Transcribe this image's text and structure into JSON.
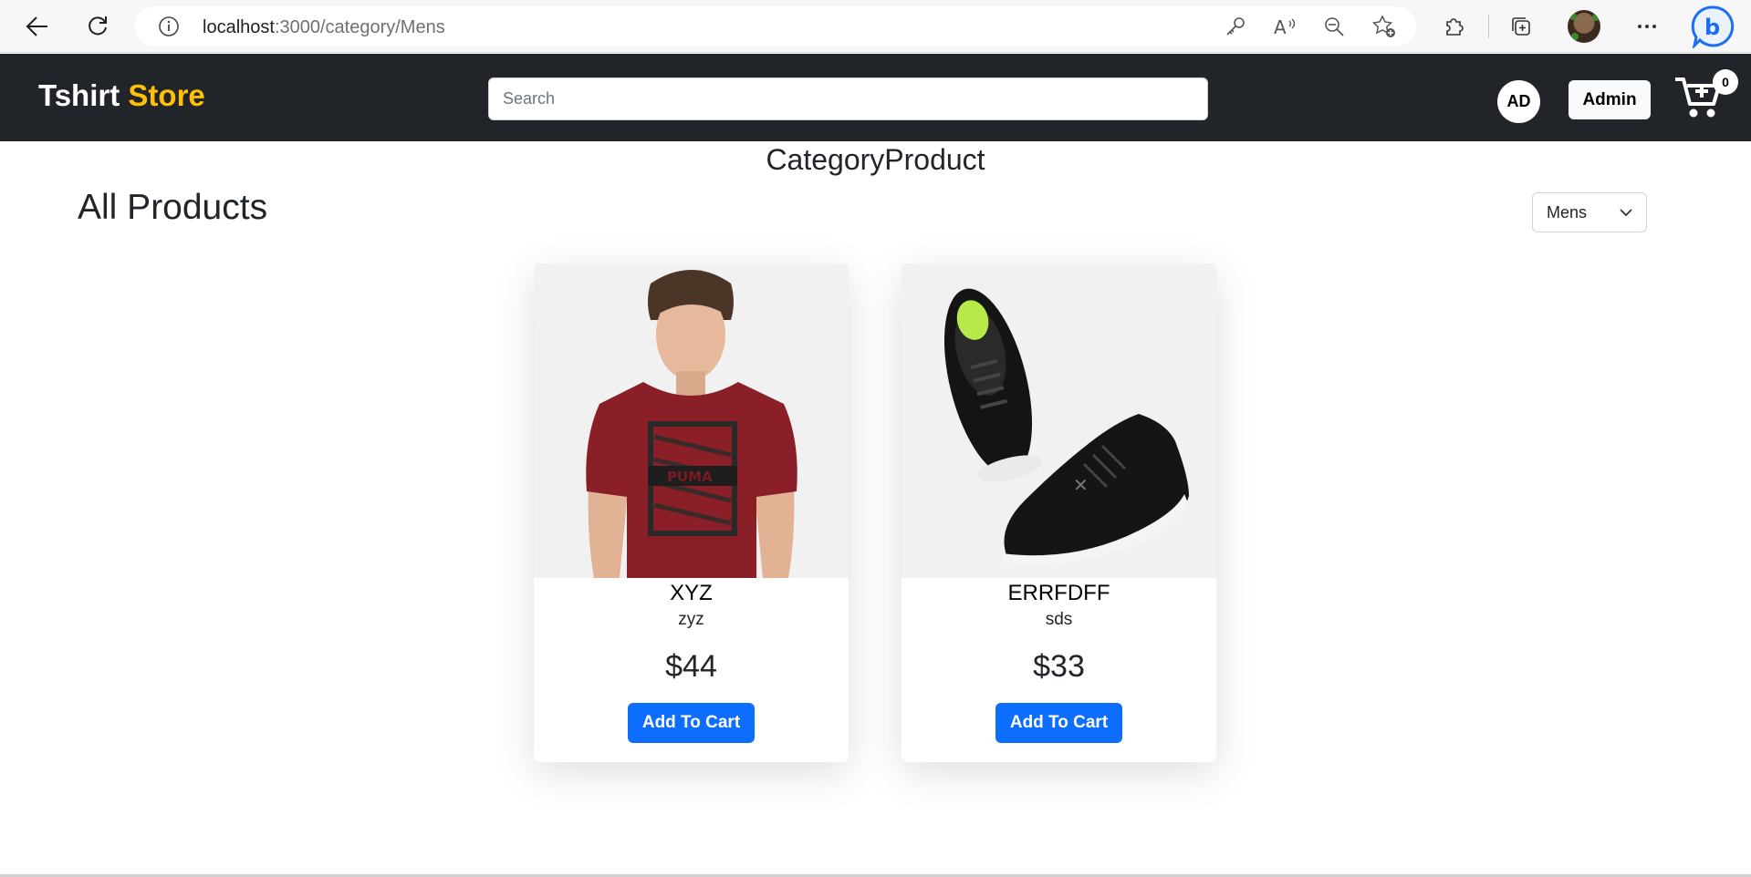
{
  "browser": {
    "url_host": "localhost",
    "url_path": ":3000/category/Mens"
  },
  "navbar": {
    "brand_main": "Tshirt",
    "brand_accent": "Store",
    "search_placeholder": "Search",
    "user_initials": "AD",
    "admin_label": "Admin",
    "cart_count": "0"
  },
  "page": {
    "heading": "CategoryProduct",
    "all_products": "All Products",
    "category_selected": "Mens"
  },
  "products": [
    {
      "name": "XYZ",
      "description": "zyz",
      "price": "$44",
      "button": "Add To Cart"
    },
    {
      "name": "ERRFDFF",
      "description": "sds",
      "price": "$33",
      "button": "Add To Cart"
    }
  ],
  "colors": {
    "navbar_bg": "#212529",
    "brand_accent": "#ffc107",
    "primary_button": "#0d6efd"
  }
}
